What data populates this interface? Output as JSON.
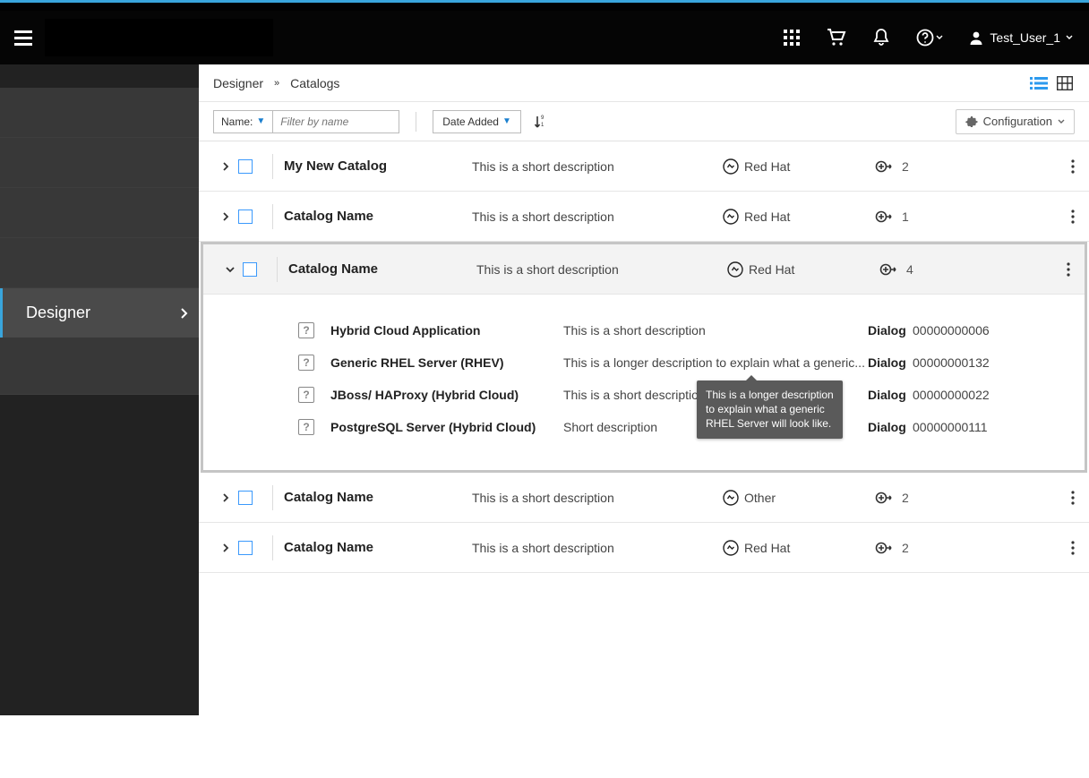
{
  "header": {
    "user_label": "Test_User_1"
  },
  "sidebar": {
    "active_label": "Designer"
  },
  "breadcrumb": {
    "root": "Designer",
    "current": "Catalogs"
  },
  "toolbar": {
    "name_label": "Name:",
    "filter_placeholder": "Filter by name",
    "sort_label": "Date Added",
    "config_label": "Configuration"
  },
  "rows": [
    {
      "name": "My New Catalog",
      "desc": "This is a short description",
      "vendor": "Red Hat",
      "count": "2",
      "expanded": false
    },
    {
      "name": "Catalog Name",
      "desc": "This is a short description",
      "vendor": "Red Hat",
      "count": "1",
      "expanded": false
    },
    {
      "name": "Catalog Name",
      "desc": "This is a short description",
      "vendor": "Red Hat",
      "count": "4",
      "expanded": true
    },
    {
      "name": "Catalog Name",
      "desc": "This is a short description",
      "vendor": "Other",
      "count": "2",
      "expanded": false
    },
    {
      "name": "Catalog Name",
      "desc": "This is a short description",
      "vendor": "Red Hat",
      "count": "2",
      "expanded": false
    }
  ],
  "sub_items": [
    {
      "name": "Hybrid Cloud Application",
      "desc": "This is a short description",
      "dlg_label": "Dialog",
      "dlg_value": "00000000006"
    },
    {
      "name": "Generic RHEL Server (RHEV)",
      "desc": "This is a longer description to explain what a generic...",
      "dlg_label": "Dialog",
      "dlg_value": "00000000132"
    },
    {
      "name": "JBoss/ HAProxy (Hybrid Cloud)",
      "desc": "This is a short description",
      "dlg_label": "Dialog",
      "dlg_value": "00000000022"
    },
    {
      "name": "PostgreSQL Server (Hybrid Cloud)",
      "desc": "Short description",
      "dlg_label": "Dialog",
      "dlg_value": "00000000111"
    }
  ],
  "tooltip": {
    "text": "This is a longer description to explain what a generic RHEL Server will look like."
  }
}
